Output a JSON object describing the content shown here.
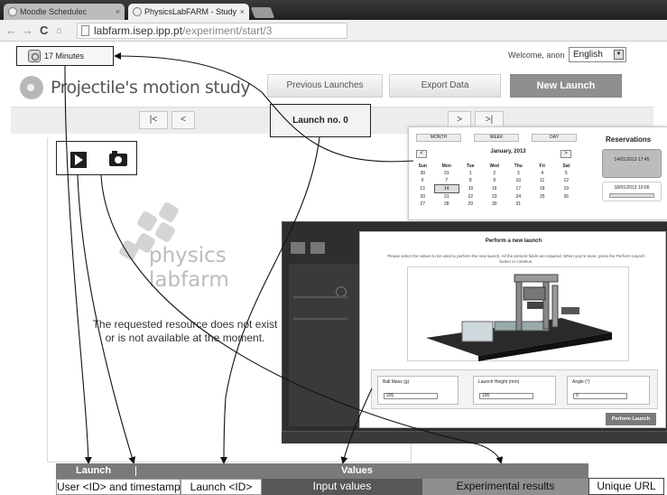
{
  "browser": {
    "tabs": [
      {
        "label": "Moodle Schedulec",
        "close": "×"
      },
      {
        "label": "PhysicsLabFARM - Study",
        "close": "×"
      }
    ],
    "back_icon": "back-arrow-icon",
    "forward_icon": "forward-arrow-icon",
    "reload_label": "C",
    "url_host": "labfarm.isep.ipp.pt",
    "url_path": "/experiment/start/3"
  },
  "header": {
    "timer_label": "17 Minutes",
    "welcome": "Welcome, anon",
    "language": "English",
    "title": "Projectile's motion study",
    "buttons": {
      "previous": "Previous Launches",
      "export": "Export Data",
      "new_launch": "New Launch"
    }
  },
  "launch_nav": {
    "first": "|<",
    "prev": "<",
    "current": "Launch no. 0",
    "next": ">",
    "last": ">|"
  },
  "main": {
    "play_icon": "play-icon",
    "camera_icon": "camera-icon",
    "brand_line1": "physics",
    "brand_line2": "labfarm",
    "error_message": "The requested resource does not exist or is not available at the moment."
  },
  "reservations": {
    "title": "Reservations",
    "views": [
      "MONTH",
      "WEEK",
      "DAY"
    ],
    "prev": "<",
    "next": ">",
    "month": "January, 2013",
    "weekdays": [
      "Sun",
      "Mon",
      "Tue",
      "Wed",
      "Thu",
      "Fri",
      "Sat"
    ],
    "weeks": [
      [
        "30",
        "31",
        "1",
        "2",
        "3",
        "4",
        "5"
      ],
      [
        "6",
        "7",
        "8",
        "9",
        "10",
        "11",
        "12"
      ],
      [
        "13",
        "14",
        "15",
        "16",
        "17",
        "18",
        "19"
      ],
      [
        "20",
        "21",
        "22",
        "23",
        "24",
        "25",
        "26"
      ],
      [
        "27",
        "28",
        "29",
        "30",
        "31",
        "",
        ""
      ]
    ],
    "selected_day": "14",
    "slot1": "14/01/2013 17:45",
    "slot2": "18/01/2013 10:00"
  },
  "modal": {
    "title": "Perform a new launch",
    "description": "Please select the values to be used to perform the new launch. All the present fields are required. When you're done, press the Perform Launch button to continue.",
    "fields": [
      {
        "label": "Ball Mass (g)",
        "value": "200"
      },
      {
        "label": "Launch Height (mm)",
        "value": "100"
      },
      {
        "label": "Angle (°)",
        "value": "0"
      }
    ],
    "submit": "Perform Launch"
  },
  "legend": {
    "launch": "Launch",
    "values": "Values",
    "cells": [
      "User <ID> and timestamp",
      "Launch <ID>",
      "Input values",
      "Experimental results",
      "Unique URL"
    ]
  }
}
